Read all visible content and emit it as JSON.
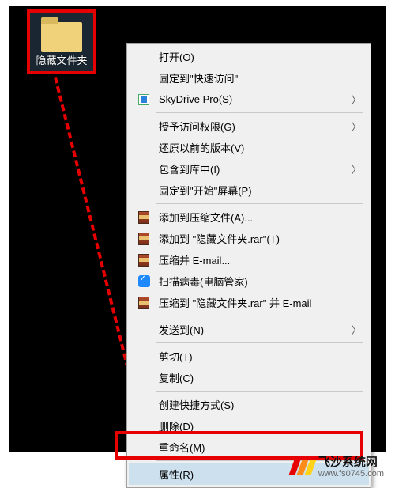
{
  "folder": {
    "label": "隐藏文件夹"
  },
  "menu": {
    "open": "打开(O)",
    "pin_quick": "固定到\"快速访问\"",
    "skydrive": "SkyDrive Pro(S)",
    "grant_access": "授予访问权限(G)",
    "restore": "还原以前的版本(V)",
    "include_library": "包含到库中(I)",
    "pin_start": "固定到\"开始\"屏幕(P)",
    "add_archive": "添加到压缩文件(A)...",
    "add_rar": "添加到 \"隐藏文件夹.rar\"(T)",
    "zip_email": "压缩并 E-mail...",
    "zip_rar_email": "压缩到 \"隐藏文件夹.rar\" 并 E-mail",
    "scan": "扫描病毒(电脑管家)",
    "send_to": "发送到(N)",
    "cut": "剪切(T)",
    "copy": "复制(C)",
    "shortcut": "创建快捷方式(S)",
    "delete": "删除(D)",
    "rename": "重命名(M)",
    "properties": "属性(R)"
  },
  "watermark": {
    "line1": "飞沙系统网",
    "line2": "www.fs0745.com"
  }
}
